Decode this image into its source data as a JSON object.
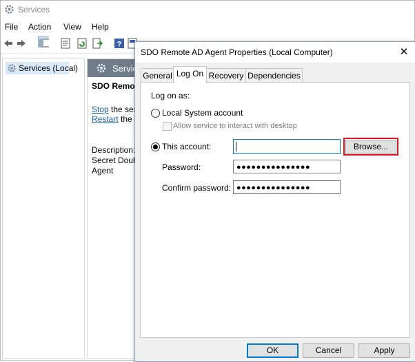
{
  "app": {
    "title": "Services",
    "icon": "gear-icon"
  },
  "menu": [
    "File",
    "Action",
    "View",
    "Help"
  ],
  "tree": {
    "root_label": "Services (Local)"
  },
  "services_pane": {
    "header": "Services",
    "service_name": "SDO Remote AD Agent",
    "stop_link": "Stop",
    "stop_suffix": " the service",
    "restart_link": "Restart",
    "restart_suffix": " the service",
    "description_label": "Description:",
    "description_line1": "Secret Double Octopus",
    "description_line2": "Agent"
  },
  "dialog": {
    "title": "SDO Remote AD Agent Properties (Local Computer)",
    "close": "✕",
    "tabs": [
      "General",
      "Log On",
      "Recovery",
      "Dependencies"
    ],
    "active_tab": "Log On",
    "log_on_as": "Log on as:",
    "local_system_label": "Local System account",
    "allow_interact_label": "Allow service to interact with desktop",
    "this_account_label": "This account:",
    "account_value": "",
    "browse_label": "Browse...",
    "password_label": "Password:",
    "password_value": "●●●●●●●●●●●●●●●",
    "confirm_label": "Confirm password:",
    "confirm_value": "●●●●●●●●●●●●●●●",
    "ok_label": "OK",
    "cancel_label": "Cancel",
    "apply_label": "Apply",
    "selected_option": "this_account"
  },
  "colors": {
    "highlight": "#e0161f",
    "link": "#1a5fb4",
    "header_bg": "#6f7d8a"
  }
}
